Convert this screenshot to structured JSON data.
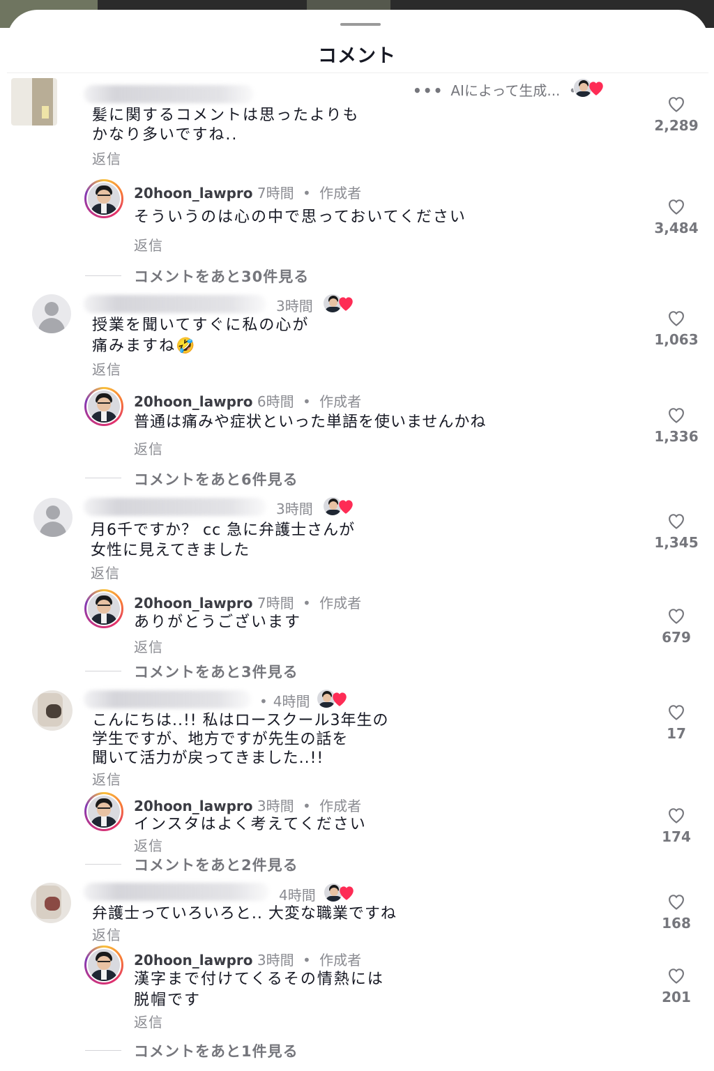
{
  "sheet": {
    "title": "コメント"
  },
  "labels": {
    "reply": "返信",
    "author_tag": "作成者",
    "dot": "•"
  },
  "ai_label": {
    "ellipsis": "•••",
    "text": "AIによって生成...",
    "dot": "•"
  },
  "comments": [
    {
      "time": "",
      "text": "髪に関するコメントは思ったよりも\nかなり多いですね..",
      "likes": "2,289",
      "reply": {
        "username": "20hoon_lawpro",
        "time": "7時間",
        "text": "そういうのは心の中で思っておいてください",
        "likes": "3,484"
      },
      "more": "コメントをあと30件見る"
    },
    {
      "time": "3時間",
      "text": "授業を聞いてすぐに私の心が\n痛みますね🤣",
      "likes": "1,063",
      "reply": {
        "username": "20hoon_lawpro",
        "time": "6時間",
        "text": "普通は痛みや症状といった単語を使いませんかね",
        "likes": "1,336"
      },
      "more": "コメントをあと6件見る"
    },
    {
      "time": "3時間",
      "text": "月6千ですか？ cc 急に弁護士さんが\n女性に見えてきました",
      "likes": "1,345",
      "reply": {
        "username": "20hoon_lawpro",
        "time": "7時間",
        "text": "ありがとうございます",
        "likes": "679"
      },
      "more": "コメントをあと3件見る"
    },
    {
      "time": "4時間",
      "text": "こんにちは..!! 私はロースクール3年生の\n学生ですが、地方ですが先生の話を\n聞いて活力が戻ってきました..!!",
      "likes": "17",
      "reply": {
        "username": "20hoon_lawpro",
        "time": "3時間",
        "text": "インスタはよく考えてください",
        "likes": "174"
      },
      "more": "コメントをあと2件見る"
    },
    {
      "time": "4時間",
      "text": "弁護士っていろいろと.. 大変な職業ですね",
      "likes": "168",
      "reply": {
        "username": "20hoon_lawpro",
        "time": "3時間",
        "text": "漢字まで付けてくるその情熱には\n脱帽です",
        "likes": "201"
      },
      "more": "コメントをあと1件見る"
    }
  ],
  "icons": {
    "like": "heart-outline-icon",
    "creator_liked": "creator-liked-heart-icon",
    "default_avatar": "default-user-avatar-icon"
  },
  "colors": {
    "background": "#ffffff",
    "text": "#161823",
    "secondary_text": "#8a8b91",
    "liked_red": "#fe2c55"
  }
}
